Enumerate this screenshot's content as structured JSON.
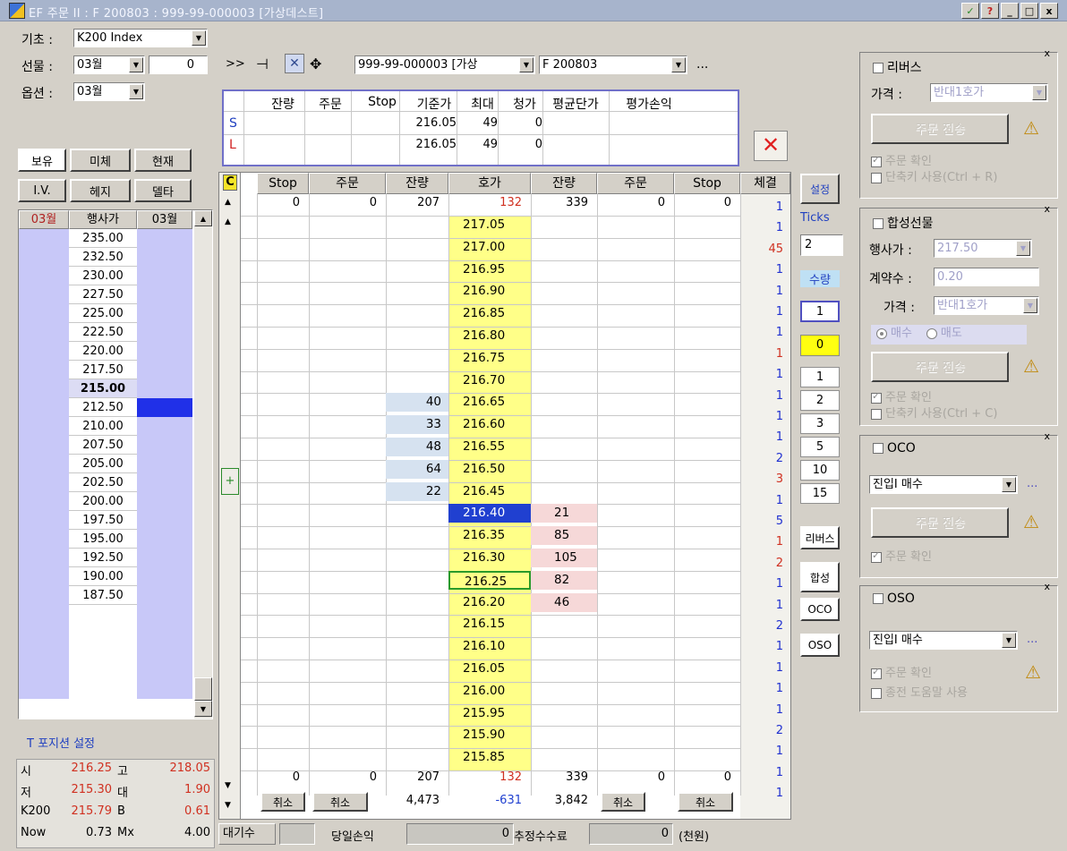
{
  "window": {
    "title": "EF 주문 II : F 200803 : 999-99-000003 [가상데스트]",
    "buttons": [
      "✓",
      "?",
      "_",
      "□",
      "x"
    ]
  },
  "left": {
    "base_label": "기초 :",
    "base_value": "K200 Index",
    "futures_label": "선물 :",
    "futures_month": "03월",
    "futures_qty": "0",
    "option_label": "옵션 :",
    "option_month": "03월",
    "tabs_row1": [
      "보유",
      "미체",
      "현재"
    ],
    "tabs_row2": [
      "I.V.",
      "헤지",
      "델타"
    ],
    "strike_header": [
      "03월",
      "행사가",
      "03월"
    ],
    "strikes": [
      "235.00",
      "232.50",
      "230.00",
      "227.50",
      "225.00",
      "222.50",
      "220.00",
      "217.50",
      "215.00",
      "212.50",
      "210.00",
      "207.50",
      "205.00",
      "202.50",
      "200.00",
      "197.50",
      "195.00",
      "192.50",
      "190.00",
      "187.50"
    ],
    "position_label": "T 포지션 설정",
    "stats": [
      {
        "k1": "시",
        "v1": "216.25",
        "k2": "고",
        "v2": "218.05"
      },
      {
        "k1": "저",
        "v1": "215.30",
        "k2": "대",
        "v2": "1.90"
      },
      {
        "k1": "K200",
        "v1": "215.79",
        "k2": "B",
        "v2": "0.61"
      },
      {
        "k1": "Now",
        "v1": "0.73",
        "k2": "Mx",
        "v2": "4.00"
      }
    ]
  },
  "toolbar": {
    "expand": ">>",
    "account": "999-99-000003 [가상",
    "symbol": "F 200803",
    "more": "..."
  },
  "position_table": {
    "headers": [
      "잔량",
      "주문",
      "Stop",
      "기준가",
      "최대",
      "청가",
      "평균단가",
      "평가손익"
    ],
    "rows": [
      {
        "side": "S",
        "base": "216.05",
        "max": "49",
        "clear": "0"
      },
      {
        "side": "L",
        "base": "216.05",
        "max": "49",
        "clear": "0"
      }
    ]
  },
  "ladder": {
    "headers": [
      "Stop",
      "주문",
      "잔량",
      "호가",
      "잔량",
      "주문",
      "Stop",
      "체결"
    ],
    "top_row": {
      "stop_l": "0",
      "order_l": "0",
      "rem_l": "207",
      "price": "132",
      "rem_r": "339",
      "order_r": "0",
      "stop_r": "0"
    },
    "bottom_row": {
      "stop_l": "0",
      "order_l": "0",
      "rem_l": "207",
      "price": "132",
      "rem_r": "339",
      "order_r": "0",
      "stop_r": "0"
    },
    "totals": {
      "cancel": "취소",
      "rem_l": "4,473",
      "diff": "-631",
      "rem_r": "3,842"
    },
    "prices": [
      "217.05",
      "217.00",
      "216.95",
      "216.90",
      "216.85",
      "216.80",
      "216.75",
      "216.70",
      "216.65",
      "216.60",
      "216.55",
      "216.50",
      "216.45",
      "216.40",
      "216.35",
      "216.30",
      "216.25",
      "216.20",
      "216.15",
      "216.10",
      "216.05",
      "216.00",
      "215.95",
      "215.90",
      "215.85"
    ],
    "bid_qty": [
      "",
      "",
      "",
      "",
      "",
      "",
      "",
      "",
      "40",
      "33",
      "48",
      "64",
      "22",
      "",
      "",
      "",
      "",
      "",
      "",
      "",
      "",
      "",
      "",
      "",
      ""
    ],
    "ask_qty": [
      "",
      "",
      "",
      "",
      "",
      "",
      "",
      "",
      "",
      "",
      "",
      "",
      "",
      "21",
      "85",
      "105",
      "82",
      "46",
      "",
      "",
      "",
      "",
      "",
      "",
      ""
    ],
    "fills": [
      "1",
      "1",
      "45",
      "1",
      "1",
      "1",
      "1",
      "1",
      "1",
      "1",
      "1",
      "1",
      "2",
      "3",
      "1",
      "5",
      "1",
      "2",
      "1",
      "1",
      "2",
      "1",
      "1",
      "1",
      "1",
      "2",
      "1",
      "1",
      "1"
    ],
    "fill_colors": [
      "#2030d0",
      "#2030d0",
      "#d03020",
      "#2030d0",
      "#2030d0",
      "#2030d0",
      "#2030d0",
      "#d03020",
      "#2030d0",
      "#2030d0",
      "#2030d0",
      "#2030d0",
      "#2030d0",
      "#d03020",
      "#2030d0",
      "#2030d0",
      "#d03020",
      "#d03020",
      "#2030d0",
      "#2030d0",
      "#2030d0",
      "#2030d0",
      "#2030d0",
      "#2030d0",
      "#2030d0",
      "#2030d0",
      "#2030d0",
      "#2030d0",
      "#2030d0"
    ],
    "current_price": "216.40",
    "marked_price": "216.25"
  },
  "status": {
    "wait": "대기수",
    "daily_pnl": "당일손익",
    "daily_val": "0",
    "fee": "추정수수료",
    "fee_val": "0",
    "unit": "(천원)"
  },
  "side": {
    "settings": "설정",
    "ticks": "Ticks",
    "ticks_val": "2",
    "qty": "수량",
    "qty_val": "1",
    "yellow_val": "0",
    "tick_opts": [
      "1",
      "2",
      "3",
      "5",
      "10",
      "15"
    ],
    "buttons": [
      "리버스",
      "합성",
      "OCO",
      "OSO"
    ]
  },
  "right": {
    "reverse": {
      "title": "리버스",
      "price_label": "가격 :",
      "price_val": "반대1호가",
      "action": "주문 전송",
      "confirm": "주문 확인",
      "shortcut": "단축키 사용(Ctrl + R)"
    },
    "synth": {
      "title": "합성선물",
      "strike_label": "행사가 :",
      "strike_val": "217.50",
      "qty_label": "계약수 :",
      "qty_val": "0.20",
      "price_label": "가격 :",
      "price_val": "반대1호가",
      "buy": "매수",
      "sell": "매도",
      "action": "주문 전송",
      "confirm": "주문 확인",
      "shortcut": "단축키 사용(Ctrl + C)"
    },
    "oco": {
      "title": "OCO",
      "combo": "진입I 매수",
      "action": "주문 전송",
      "confirm": "주문 확인"
    },
    "oso": {
      "title": "OSO",
      "combo": "진입I 매수",
      "confirm": "주문 확인",
      "shortcut": "종전 도움말 사용"
    }
  },
  "colors": {
    "price_col": "#ffff88",
    "bid_bg": "#d6e2f0",
    "ask_bg": "#f6d8d8",
    "current": "#2040d0",
    "lavender": "#c8c8f8",
    "highlight": "#2030e8"
  }
}
